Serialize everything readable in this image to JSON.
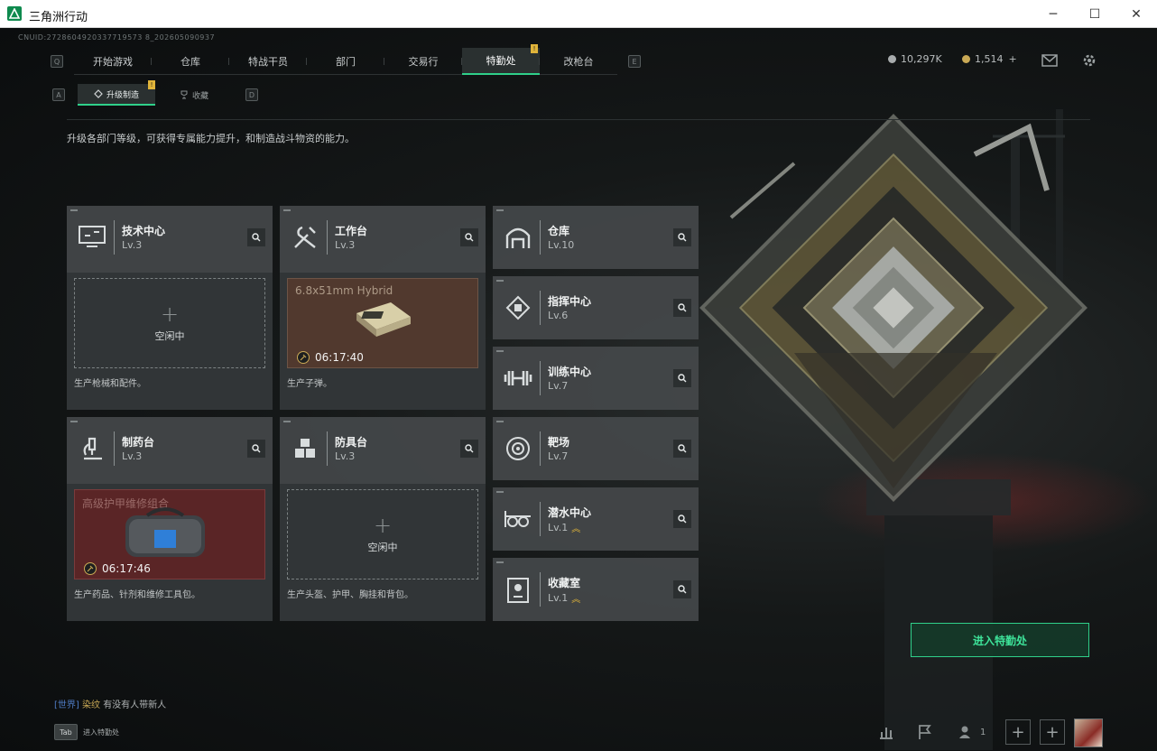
{
  "window": {
    "title": "三角洲行动",
    "minimize": "─",
    "maximize": "☐",
    "close": "✕"
  },
  "cnuid": "CNUID:2728604920337719573 8_202605090937",
  "nav": {
    "left_key": "Q",
    "right_key": "E",
    "tabs": [
      {
        "label": "开始游戏"
      },
      {
        "label": "仓库"
      },
      {
        "label": "特战干员"
      },
      {
        "label": "部门"
      },
      {
        "label": "交易行"
      },
      {
        "label": "特勤处",
        "active": true,
        "badge": "!"
      },
      {
        "label": "改枪台"
      }
    ]
  },
  "currency": {
    "silver": "10,297K",
    "gold": "1,514",
    "gold_add": "+"
  },
  "subnav": {
    "left_key": "A",
    "right_key": "D",
    "tabs": [
      {
        "label": "升级制造",
        "active": true,
        "badge": "!"
      },
      {
        "label": "收藏"
      }
    ]
  },
  "description": "升级各部门等级，可获得专属能力提升，和制造战斗物资的能力。",
  "cards_large": [
    {
      "name": "技术中心",
      "level": "Lv.3",
      "icon": "monitor-icon",
      "status": "empty",
      "slot_text": "空闲中",
      "desc": "生产枪械和配件。"
    },
    {
      "name": "工作台",
      "level": "Lv.3",
      "icon": "tools-icon",
      "status": "producing",
      "item": "6.8x51mm Hybrid",
      "timer": "06:17:40",
      "desc": "生产子弹。"
    },
    {
      "name": "制药台",
      "level": "Lv.3",
      "icon": "microscope-icon",
      "status": "producing",
      "item": "高级护甲维修组合",
      "timer": "06:17:46",
      "desc": "生产药品、针剂和维修工具包。"
    },
    {
      "name": "防具台",
      "level": "Lv.3",
      "icon": "armor-icon",
      "status": "empty",
      "slot_text": "空闲中",
      "desc": "生产头盔、护甲、胸挂和背包。"
    }
  ],
  "cards_small": [
    {
      "name": "仓库",
      "level": "Lv.10",
      "icon": "warehouse-icon",
      "upgrade": ""
    },
    {
      "name": "指挥中心",
      "level": "Lv.6",
      "icon": "chip-icon",
      "upgrade": ""
    },
    {
      "name": "训练中心",
      "level": "Lv.7",
      "icon": "dumbbell-icon",
      "upgrade": ""
    },
    {
      "name": "靶场",
      "level": "Lv.7",
      "icon": "target-icon",
      "upgrade": ""
    },
    {
      "name": "潜水中心",
      "level": "Lv.1",
      "icon": "goggles-icon",
      "upgrade": "︽"
    },
    {
      "name": "收藏室",
      "level": "Lv.1",
      "icon": "trophy-icon",
      "upgrade": "︽"
    }
  ],
  "enter_button": "进入特勤处",
  "chat": {
    "channel": "[世界]",
    "user": "染纹",
    "message": "有没有人带新人"
  },
  "tab_hint": {
    "key": "Tab",
    "label": "进入特勤处"
  },
  "friends_count": "1",
  "colors": {
    "accent": "#2fd08a",
    "badge": "#e0b43a",
    "card": "#44484a"
  }
}
